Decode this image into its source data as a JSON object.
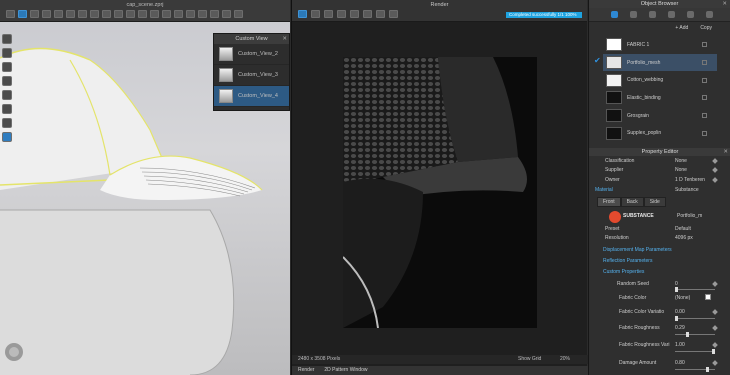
{
  "viewport": {
    "title": "cap_scene.zprj",
    "custom_view": {
      "title": "Custom View",
      "items": [
        {
          "label": "Custom_View_2",
          "active": false
        },
        {
          "label": "Custom_View_3",
          "active": false
        },
        {
          "label": "Custom_View_4",
          "active": true
        }
      ]
    }
  },
  "render": {
    "title": "Render",
    "progress_text": "Completed successfully  1/1  100%",
    "resolution_label": "2480 x 3508 Pixels",
    "show_grid": "Show Grid",
    "zoom": "20%",
    "bottom_tabs": [
      "Render",
      "2D Pattern Window"
    ]
  },
  "object_browser": {
    "title": "Object Browser",
    "add_label": "+ Add",
    "copy_label": "Copy",
    "items": [
      {
        "name": "FABRIC 1",
        "swatch": "#ffffff",
        "selected": false
      },
      {
        "name": "Portfolio_mesh",
        "swatch": "#e6e6e6",
        "selected": true
      },
      {
        "name": "Cotton_webbing",
        "swatch": "#f2f2f2",
        "selected": false
      },
      {
        "name": "Elastic_binding",
        "swatch": "#111111",
        "selected": false
      },
      {
        "name": "Grosgrain",
        "swatch": "#111111",
        "selected": false
      },
      {
        "name": "Supplex_poplin",
        "swatch": "#111111",
        "selected": false
      }
    ]
  },
  "property_editor": {
    "title": "Property Editor",
    "classification": {
      "label": "Classification",
      "value": "None"
    },
    "supplier": {
      "label": "Supplier",
      "value": "None"
    },
    "owner": {
      "label": "Owner",
      "value": "1 D Tenberen"
    },
    "material_section": "Material",
    "material_type": "Substance",
    "tabs": [
      "Front",
      "Back",
      "Side"
    ],
    "substance_label": "SUBSTANCE",
    "substance_name": "Portfolio_m",
    "preset": {
      "label": "Preset",
      "value": "Default"
    },
    "resolution": {
      "label": "Resolution",
      "value": "4096 px"
    },
    "sections": [
      "Displacement Map Parameters",
      "Reflection Parameters",
      "Custom Properties"
    ],
    "random_seed": {
      "label": "Random Seed",
      "value": "0"
    },
    "fabric_color": {
      "label": "Fabric Color",
      "value": "(None)"
    },
    "fabric_color_variation": {
      "label": "Fabric Color Variatio",
      "value": "0.00"
    },
    "fabric_roughness": {
      "label": "Fabric Roughness",
      "value": "0.29"
    },
    "fabric_roughness_variation": {
      "label": "Fabric Roughness Vari",
      "value": "1.00"
    },
    "damage_amount": {
      "label": "Damage Amount",
      "value": "0.80"
    }
  }
}
